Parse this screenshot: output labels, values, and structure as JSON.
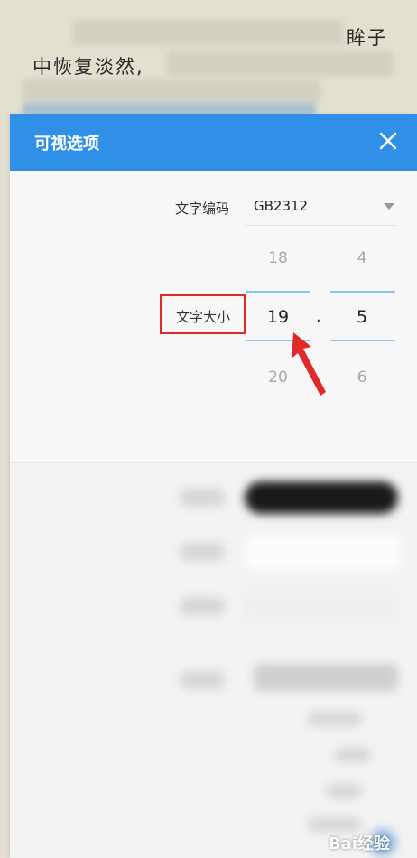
{
  "reader": {
    "line1_text": "眸子",
    "line2_text": "中恢复淡然,"
  },
  "dialog": {
    "title": "可视选项",
    "encoding": {
      "label": "文字编码",
      "value": "GB2312"
    },
    "font_size": {
      "label": "文字大小",
      "integer": {
        "prev": "18",
        "selected": "19",
        "next": "20"
      },
      "separator": ".",
      "decimal": {
        "prev": "4",
        "selected": "5",
        "next": "6"
      }
    }
  },
  "colors": {
    "header": "#3090e8",
    "annotation": "#e02a2a"
  },
  "icons": {
    "close": "close-icon",
    "dropdown": "chevron-down-icon",
    "annotation": "arrow-annotation-icon"
  },
  "watermark": {
    "text": "Bai经验"
  }
}
